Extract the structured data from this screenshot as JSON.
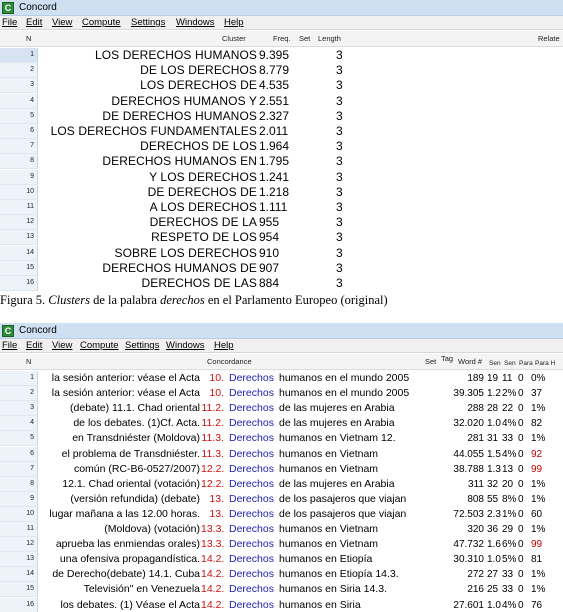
{
  "window1": {
    "title": "Concord",
    "menu": [
      "File",
      "Edit",
      "View",
      "Compute",
      "Settings",
      "Windows",
      "Help"
    ],
    "columns": {
      "n": "N",
      "cluster": "Cluster",
      "freq": "Freq.",
      "set": "Set",
      "length": "Length",
      "related": "Relate"
    },
    "rows": [
      {
        "n": "1",
        "cluster": "LOS DERECHOS HUMANOS",
        "freq": "9.395",
        "length": "3"
      },
      {
        "n": "2",
        "cluster": "DE LOS DERECHOS",
        "freq": "8.779",
        "length": "3"
      },
      {
        "n": "3",
        "cluster": "LOS DERECHOS DE",
        "freq": "4.535",
        "length": "3"
      },
      {
        "n": "4",
        "cluster": "DERECHOS HUMANOS Y",
        "freq": "2.551",
        "length": "3"
      },
      {
        "n": "5",
        "cluster": "DE DERECHOS HUMANOS",
        "freq": "2.327",
        "length": "3"
      },
      {
        "n": "6",
        "cluster": "LOS DERECHOS FUNDAMENTALES",
        "freq": "2.011",
        "length": "3"
      },
      {
        "n": "7",
        "cluster": "DERECHOS DE LOS",
        "freq": "1.964",
        "length": "3"
      },
      {
        "n": "8",
        "cluster": "DERECHOS HUMANOS EN",
        "freq": "1.795",
        "length": "3"
      },
      {
        "n": "9",
        "cluster": "Y LOS DERECHOS",
        "freq": "1.241",
        "length": "3"
      },
      {
        "n": "10",
        "cluster": "DE DERECHOS DE",
        "freq": "1.218",
        "length": "3"
      },
      {
        "n": "11",
        "cluster": "A LOS DERECHOS",
        "freq": "1.111",
        "length": "3"
      },
      {
        "n": "12",
        "cluster": "DERECHOS DE LA",
        "freq": "955",
        "length": "3"
      },
      {
        "n": "13",
        "cluster": "RESPETO DE LOS",
        "freq": "954",
        "length": "3"
      },
      {
        "n": "14",
        "cluster": "SOBRE LOS DERECHOS",
        "freq": "910",
        "length": "3"
      },
      {
        "n": "15",
        "cluster": "DERECHOS HUMANOS DE",
        "freq": "907",
        "length": "3"
      },
      {
        "n": "16",
        "cluster": "DERECHOS DE LAS",
        "freq": "884",
        "length": "3"
      }
    ]
  },
  "caption": {
    "prefix": "Figura 5. ",
    "italic1": "Clusters",
    "middle": " de la palabra ",
    "italic2": "derechos",
    "suffix": " en el Parlamento Europeo (original)"
  },
  "window2": {
    "title": "Concord",
    "menu": [
      "File",
      "Edit",
      "View",
      "Compute",
      "Settings",
      "Windows",
      "Help"
    ],
    "columns": {
      "n": "N",
      "concordance": "Concordance",
      "set": "Set",
      "tag": "Tag",
      "word": "Word #",
      "sen1": "Sen",
      "sen2": "Sen",
      "para1": "Para",
      "para2": "Para H"
    },
    "rows": [
      {
        "n": "1",
        "left": "la sesión anterior: véase el Acta",
        "num": "10.",
        "word": "Derechos",
        "right": "humanos en el mundo 2005",
        "wordno": "189",
        "s1": "19",
        "s2": "11",
        "p1": "0",
        "p2": "0%",
        "red": false
      },
      {
        "n": "2",
        "left": "la sesión anterior: véase el Acta",
        "num": "10.",
        "word": "Derechos",
        "right": "humanos en el mundo 2005",
        "wordno": "39.305",
        "s1": "1.2",
        "s2": "2%",
        "p1": "0",
        "p2": "37",
        "red": false
      },
      {
        "n": "3",
        "left": "(debate) 11.1. Chad oriental",
        "num": "11.2.",
        "word": "Derechos",
        "right": "de las mujeres en Arabia",
        "wordno": "288",
        "s1": "28",
        "s2": "22",
        "p1": "0",
        "p2": "1%",
        "red": false
      },
      {
        "n": "4",
        "left": "de los debates. (1)Cf. Acta.",
        "num": "11.2.",
        "word": "Derechos",
        "right": "de las mujeres en Arabia",
        "wordno": "32.020",
        "s1": "1.0",
        "s2": "4%",
        "p1": "0",
        "p2": "82",
        "red": false
      },
      {
        "n": "5",
        "left": "en Transdniéster (Moldova)",
        "num": "11.3.",
        "word": "Derechos",
        "right": "humanos en Vietnam 12.",
        "wordno": "281",
        "s1": "31",
        "s2": "33",
        "p1": "0",
        "p2": "1%",
        "red": false
      },
      {
        "n": "6",
        "left": "el problema de Transdniéster.",
        "num": "11.3.",
        "word": "Derechos",
        "right": "humanos en Vietnam",
        "wordno": "44.055",
        "s1": "1.5",
        "s2": "4%",
        "p1": "0",
        "p2": "92",
        "red": true
      },
      {
        "n": "7",
        "left": "común (RC-B6-0527/2007)",
        "num": "12.2.",
        "word": "Derechos",
        "right": "humanos en Vietnam",
        "wordno": "38.788",
        "s1": "1.3",
        "s2": "13",
        "p1": "0",
        "p2": "99",
        "red": true
      },
      {
        "n": "8",
        "left": "12.1. Chad oriental (votación)",
        "num": "12.2.",
        "word": "Derechos",
        "right": "de las mujeres en Arabia",
        "wordno": "311",
        "s1": "32",
        "s2": "20",
        "p1": "0",
        "p2": "1%",
        "red": false
      },
      {
        "n": "9",
        "left": "(versión refundida) (debate)",
        "num": "13.",
        "word": "Derechos",
        "right": "de los pasajeros que viajan",
        "wordno": "808",
        "s1": "55",
        "s2": "8%",
        "p1": "0",
        "p2": "1%",
        "red": false
      },
      {
        "n": "10",
        "left": "lugar mañana a las 12.00 horas.",
        "num": "13.",
        "word": "Derechos",
        "right": "de los pasajeros que viajan",
        "wordno": "72.503",
        "s1": "2.3",
        "s2": "1%",
        "p1": "0",
        "p2": "60",
        "red": false
      },
      {
        "n": "11",
        "left": "(Moldova) (votación)",
        "num": "13.3.",
        "word": "Derechos",
        "right": "humanos en Vietnam",
        "wordno": "320",
        "s1": "36",
        "s2": "29",
        "p1": "0",
        "p2": "1%",
        "red": false
      },
      {
        "n": "12",
        "left": "aprueba las enmiendas orales)",
        "num": "13.3.",
        "word": "Derechos",
        "right": "humanos en Vietnam",
        "wordno": "47.732",
        "s1": "1.6",
        "s2": "6%",
        "p1": "0",
        "p2": "99",
        "red": true
      },
      {
        "n": "13",
        "left": "una ofensiva propagandística.",
        "num": "14.2.",
        "word": "Derechos",
        "right": "humanos en Etiopía",
        "wordno": "30.310",
        "s1": "1.0",
        "s2": "5%",
        "p1": "0",
        "p2": "81",
        "red": false
      },
      {
        "n": "14",
        "left": "de Derecho(debate) 14.1. Cuba",
        "num": "14.2.",
        "word": "Derechos",
        "right": "humanos en Etiopía 14.3.",
        "wordno": "272",
        "s1": "27",
        "s2": "33",
        "p1": "0",
        "p2": "1%",
        "red": false
      },
      {
        "n": "15",
        "left": "Televisión\" en Venezuela",
        "num": "14.2.",
        "word": "Derechos",
        "right": "humanos en Siria 14.3.",
        "wordno": "216",
        "s1": "25",
        "s2": "33",
        "p1": "0",
        "p2": "1%",
        "red": false
      },
      {
        "n": "16",
        "left": "los debates. (1) Véase el Acta",
        "num": "14.2.",
        "word": "Derechos",
        "right": "humanos en Siria",
        "wordno": "27.601",
        "s1": "1.0",
        "s2": "4%",
        "p1": "0",
        "p2": "76",
        "red": false
      }
    ]
  }
}
